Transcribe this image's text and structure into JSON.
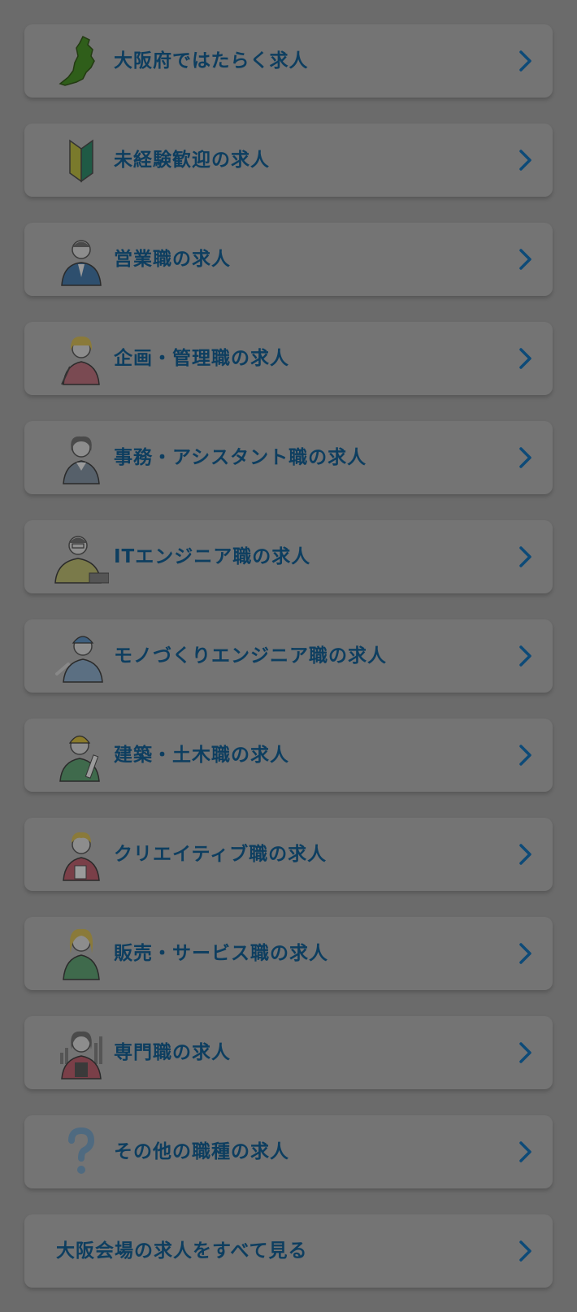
{
  "menu": {
    "items": [
      {
        "label": "大阪府ではたらく求人",
        "icon": "osaka-map-icon"
      },
      {
        "label": "未経験歓迎の求人",
        "icon": "beginner-mark-icon"
      },
      {
        "label": "営業職の求人",
        "icon": "salesperson-icon"
      },
      {
        "label": "企画・管理職の求人",
        "icon": "planner-woman-icon"
      },
      {
        "label": "事務・アシスタント職の求人",
        "icon": "office-clerk-icon"
      },
      {
        "label": "ITエンジニア職の求人",
        "icon": "it-engineer-icon"
      },
      {
        "label": "モノづくりエンジニア職の求人",
        "icon": "manufacturing-engineer-icon"
      },
      {
        "label": "建築・土木職の求人",
        "icon": "construction-worker-icon"
      },
      {
        "label": "クリエイティブ職の求人",
        "icon": "creative-worker-icon"
      },
      {
        "label": "販売・サービス職の求人",
        "icon": "sales-service-staff-icon"
      },
      {
        "label": "専門職の求人",
        "icon": "specialist-icon"
      },
      {
        "label": "その他の職種の求人",
        "icon": "question-mark-icon"
      },
      {
        "label": "大阪会場の求人をすべて見る",
        "icon": null
      }
    ]
  },
  "colors": {
    "label_text": "#0d3e60",
    "chevron": "#0d4a78",
    "card_bg": "#747474",
    "page_bg": "#6b6b6b"
  }
}
